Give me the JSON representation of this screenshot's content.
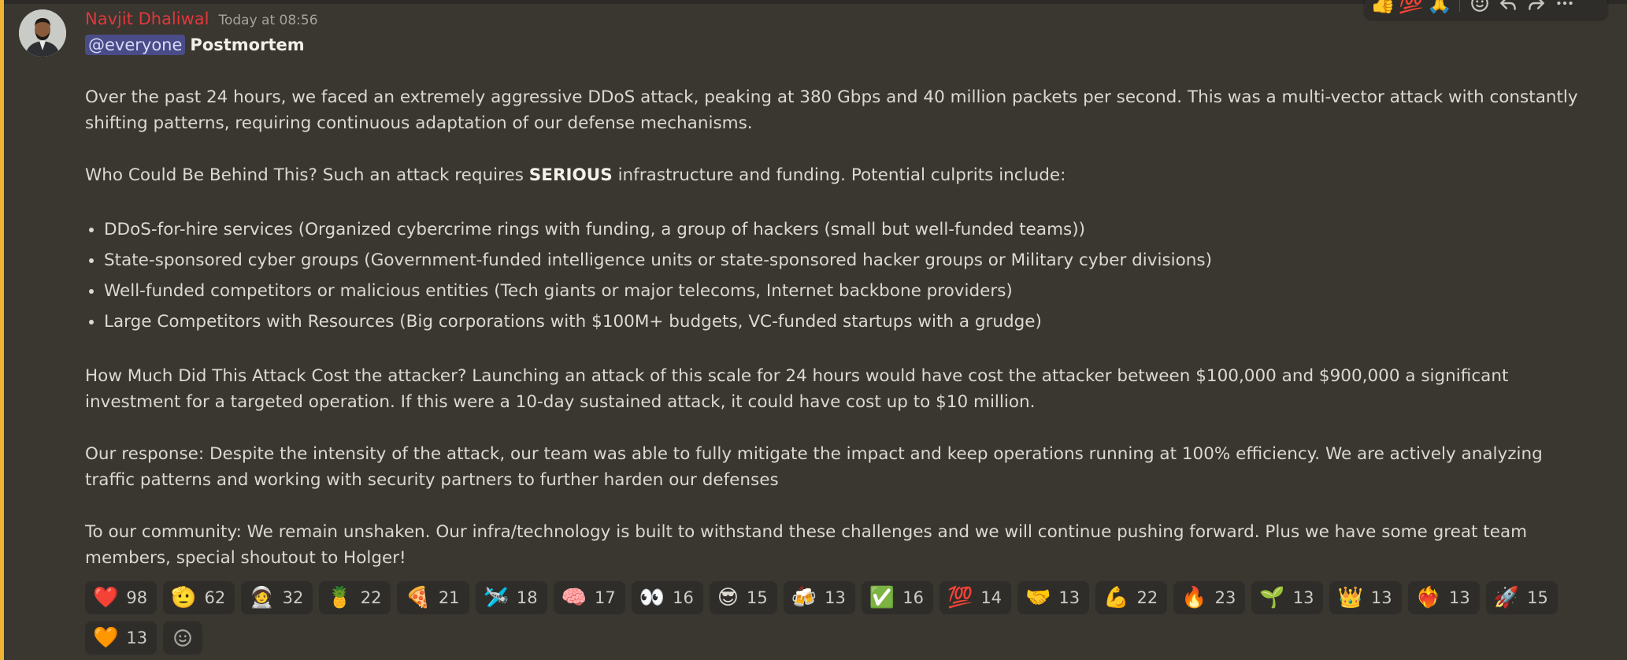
{
  "message": {
    "author": "Navjit Dhaliwal",
    "timestamp": "Today at 08:56",
    "mention": "@everyone",
    "title": "Postmortem",
    "p1": "Over the past 24 hours, we faced an extremely aggressive DDoS attack, peaking at 380 Gbps and 40 million packets per second. This was a multi-vector attack with constantly shifting patterns, requiring continuous adaptation of our defense mechanisms.",
    "p2_pre": "Who Could Be Behind This? Such an attack requires ",
    "p2_bold": "SERIOUS",
    "p2_post": " infrastructure and funding. Potential culprits include:",
    "culprits": [
      "DDoS-for-hire services (Organized cybercrime rings with funding, a group of hackers (small but well-funded teams))",
      "State-sponsored cyber groups (Government-funded intelligence units or state-sponsored hacker groups or Military cyber divisions)",
      "Well-funded competitors or malicious entities (Tech giants or major telecoms, Internet backbone providers)",
      "Large Competitors with Resources (Big corporations with $100M+ budgets, VC-funded startups with a grudge)"
    ],
    "p3": "How Much Did This Attack Cost the attacker? Launching an attack of this scale for 24 hours would have cost the attacker between $100,000 and $900,000 a significant investment for a targeted operation. If this were a 10-day sustained attack, it could have cost up to $10 million.",
    "p4": "Our response: Despite the intensity of the attack, our team was able to fully mitigate the impact and keep operations running at 100% efficiency. We are actively analyzing traffic patterns and working with security partners to further harden our defenses",
    "p5": "To our community: We remain unshaken. Our infra/technology is built to withstand these challenges and we will continue pushing forward. Plus we have some great team members, special shoutout to Holger!"
  },
  "toolbar": {
    "quick_reactions": [
      "👍",
      "💯",
      "🙏"
    ],
    "add_reaction_icon": "smiley-add-icon",
    "reply_icon": "reply-icon",
    "forward_icon": "forward-icon",
    "more_icon": "more-icon"
  },
  "reactions": [
    {
      "emoji": "❤️",
      "count": "98"
    },
    {
      "emoji": "🫡",
      "count": "62"
    },
    {
      "emoji": "🧑‍🚀",
      "count": "32"
    },
    {
      "emoji": "🍍",
      "count": "22"
    },
    {
      "emoji": "🍕",
      "count": "21"
    },
    {
      "emoji": "🛩️",
      "count": "18"
    },
    {
      "emoji": "🧠",
      "count": "17"
    },
    {
      "emoji": "👀",
      "count": "16"
    },
    {
      "emoji": "😎",
      "count": "15"
    },
    {
      "emoji": "🍻",
      "count": "13"
    },
    {
      "emoji": "✅",
      "count": "16"
    },
    {
      "emoji": "💯",
      "count": "14"
    },
    {
      "emoji": "🤝",
      "count": "13"
    },
    {
      "emoji": "💪",
      "count": "22"
    },
    {
      "emoji": "🔥",
      "count": "23"
    },
    {
      "emoji": "🌱",
      "count": "13"
    },
    {
      "emoji": "👑",
      "count": "13"
    },
    {
      "emoji": "❤️‍🔥",
      "count": "13"
    },
    {
      "emoji": "🚀",
      "count": "15"
    },
    {
      "emoji": "🧡",
      "count": "13"
    }
  ],
  "colors": {
    "background": "#3a3630",
    "author": "#e0383b",
    "accent_bar": "#f0b232",
    "mention_bg": "#4a4c88"
  }
}
